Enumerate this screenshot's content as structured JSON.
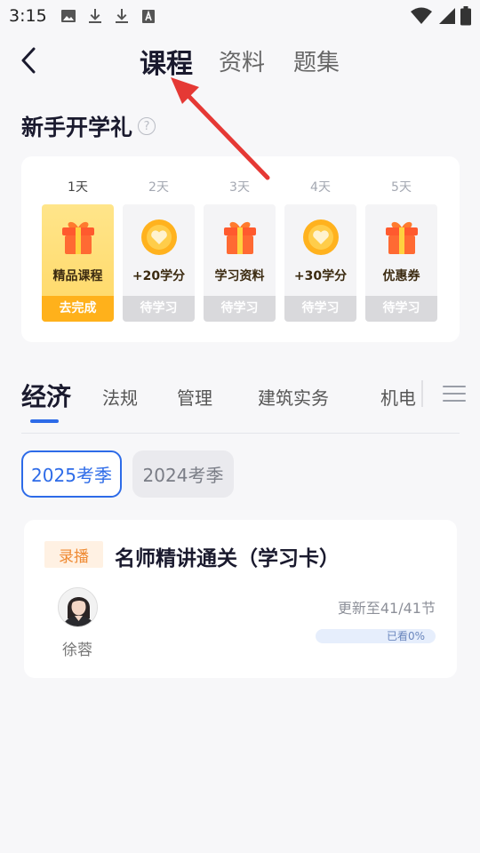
{
  "status_bar": {
    "time": "3:15",
    "left_icons": [
      "image-icon",
      "download-icon",
      "download-icon",
      "text-a-icon"
    ],
    "right_icons": [
      "wifi-icon",
      "signal-icon",
      "battery-icon"
    ]
  },
  "nav": {
    "back_icon": "chevron-left-icon",
    "tabs": [
      {
        "label": "课程",
        "active": true
      },
      {
        "label": "资料",
        "active": false
      },
      {
        "label": "题集",
        "active": false
      }
    ]
  },
  "gift": {
    "title": "新手开学礼",
    "days": [
      {
        "day": "1天",
        "reward": "精品课程",
        "status": "去完成",
        "icon": "gift-icon",
        "active": true
      },
      {
        "day": "2天",
        "reward": "+20学分",
        "status": "待学习",
        "icon": "coin-heart-icon",
        "active": false
      },
      {
        "day": "3天",
        "reward": "学习资料",
        "status": "待学习",
        "icon": "gift-icon",
        "active": false
      },
      {
        "day": "4天",
        "reward": "+30学分",
        "status": "待学习",
        "icon": "coin-heart-icon",
        "active": false
      },
      {
        "day": "5天",
        "reward": "优惠券",
        "status": "待学习",
        "icon": "gift-icon",
        "active": false
      }
    ]
  },
  "subjects": {
    "tabs": [
      {
        "label": "经济",
        "active": true
      },
      {
        "label": "法规",
        "active": false
      },
      {
        "label": "管理",
        "active": false
      },
      {
        "label": "建筑实务",
        "active": false
      },
      {
        "label": "机电",
        "active": false
      }
    ],
    "menu_icon": "menu-icon"
  },
  "seasons": [
    {
      "label": "2025考季",
      "active": true
    },
    {
      "label": "2024考季",
      "active": false
    }
  ],
  "course": {
    "tag": "录播",
    "title": "名师精讲通关（学习卡）",
    "teacher": "徐蓉",
    "update": "更新至41/41节",
    "progress_label": "已看0%",
    "progress": 0
  },
  "colors": {
    "accent": "#2d6be8",
    "gift_active": "#ffd866",
    "gift_status_active": "#ffb11b",
    "tag_text": "#ef8a33",
    "annotation_arrow": "#e53935"
  }
}
